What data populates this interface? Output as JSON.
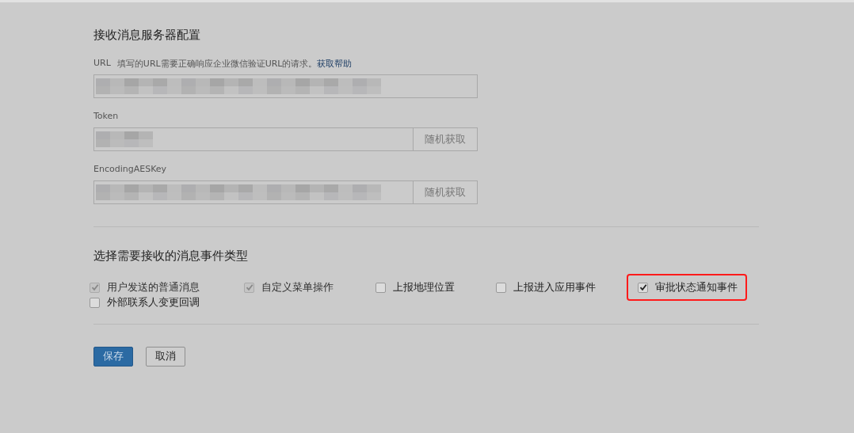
{
  "server_config": {
    "title": "接收消息服务器配置",
    "fields": [
      {
        "label": "URL",
        "hint": "填写的URL需要正确响应企业微信验证URL的请求。",
        "help_link": "获取帮助"
      },
      {
        "label": "Token",
        "button": "随机获取"
      },
      {
        "label": "EncodingAESKey",
        "button": "随机获取"
      }
    ]
  },
  "events": {
    "title": "选择需要接收的消息事件类型",
    "options": [
      {
        "label": "用户发送的普通消息",
        "checked": true,
        "disabled": true,
        "highlighted": false
      },
      {
        "label": "自定义菜单操作",
        "checked": true,
        "disabled": true,
        "highlighted": false
      },
      {
        "label": "上报地理位置",
        "checked": false,
        "disabled": false,
        "highlighted": false
      },
      {
        "label": "上报进入应用事件",
        "checked": false,
        "disabled": false,
        "highlighted": false
      },
      {
        "label": "审批状态通知事件",
        "checked": true,
        "disabled": false,
        "highlighted": true
      },
      {
        "label": "外部联系人变更回调",
        "checked": false,
        "disabled": false,
        "highlighted": false
      }
    ]
  },
  "buttons": [
    {
      "label": "保存",
      "kind": "primary"
    },
    {
      "label": "取消",
      "kind": "default"
    }
  ]
}
